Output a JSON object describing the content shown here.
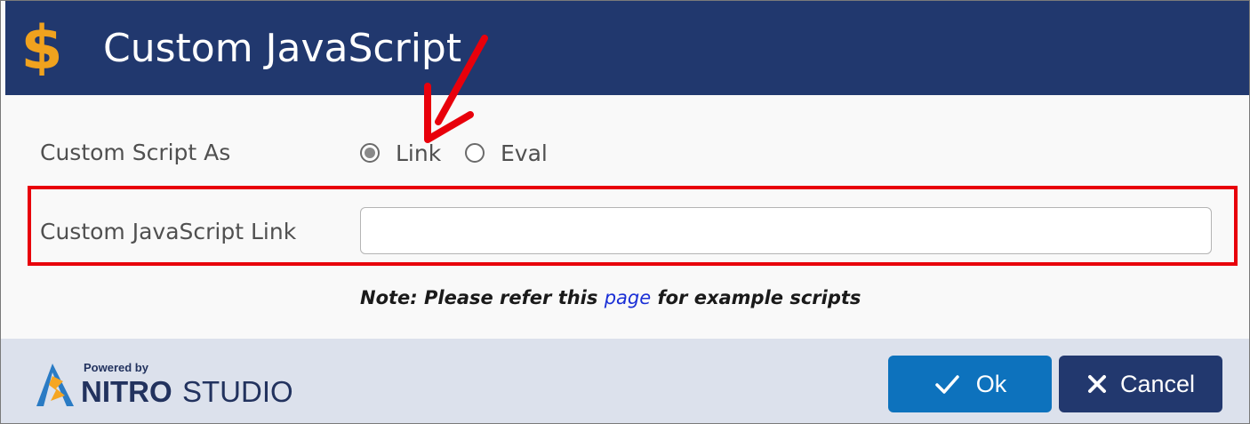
{
  "dialog": {
    "title": "Custom JavaScript",
    "header_icon": "dollar-sign-icon",
    "colors": {
      "header_bg": "#21386e",
      "dollar_icon": "#f0a21e",
      "highlight_border": "#e8000b",
      "annotation_arrow": "#e8000b",
      "link": "#1a2fd6",
      "ok_button": "#0d72bd",
      "cancel_button": "#22386e",
      "footer_bg": "#dce1ec"
    }
  },
  "form": {
    "script_as_label": "Custom Script As",
    "options": [
      {
        "label": "Link",
        "selected": true
      },
      {
        "label": "Eval",
        "selected": false
      }
    ],
    "link_label": "Custom JavaScript Link",
    "link_value": "",
    "note_prefix": "Note: Please refer this ",
    "note_link": "page",
    "note_suffix": " for example scripts"
  },
  "footer": {
    "logo_powered": "Powered by",
    "logo_nitro": "NITRO",
    "logo_studio": "STUDIO",
    "ok_label": "Ok",
    "ok_icon": "checkmark-icon",
    "cancel_label": "Cancel",
    "cancel_icon": "close-icon"
  }
}
